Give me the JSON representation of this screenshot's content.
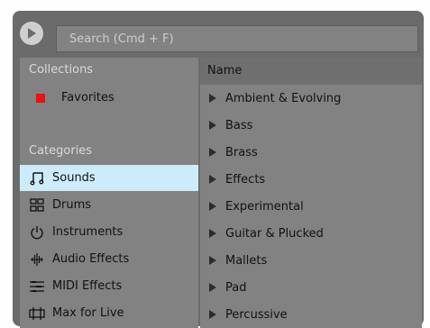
{
  "search": {
    "placeholder": "Search (Cmd + F)"
  },
  "sidebar": {
    "collections_title": "Collections",
    "favorites_label": "Favorites",
    "favorites_color": "#f20f0f",
    "categories_title": "Categories",
    "items": [
      {
        "label": "Sounds",
        "icon": "note-icon",
        "selected": true
      },
      {
        "label": "Drums",
        "icon": "grid-icon",
        "selected": false
      },
      {
        "label": "Instruments",
        "icon": "power-icon",
        "selected": false
      },
      {
        "label": "Audio Effects",
        "icon": "waveform-icon",
        "selected": false
      },
      {
        "label": "MIDI Effects",
        "icon": "midi-icon",
        "selected": false
      },
      {
        "label": "Max for Live",
        "icon": "max-icon",
        "selected": false
      }
    ]
  },
  "content": {
    "column_header": "Name",
    "rows": [
      "Ambient & Evolving",
      "Bass",
      "Brass",
      "Effects",
      "Experimental",
      "Guitar & Plucked",
      "Mallets",
      "Pad",
      "Percussive"
    ]
  },
  "colors": {
    "selection": "#ccecfb",
    "panel": "#828282",
    "header": "#6f6f6f"
  }
}
